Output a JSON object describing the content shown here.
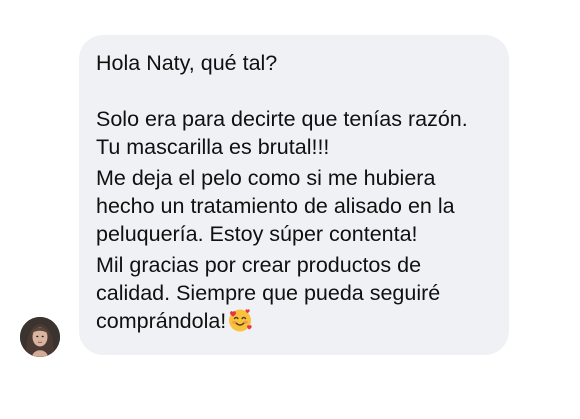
{
  "conversation": {
    "message": {
      "greeting": "Hola Naty, qué tal?",
      "paragraph_1": [
        "Solo era para decirte que tenías razón.",
        "Tu mascarilla es brutal!!!"
      ],
      "paragraph_2": [
        "Me deja el pelo como si me hubiera",
        "hecho un tratamiento de alisado en la",
        "peluquería. Estoy súper contenta!"
      ],
      "paragraph_3": [
        "Mil gracias por crear productos de",
        "calidad. Siempre que pueda seguiré",
        "comprándola!"
      ],
      "emoji_icon": "smiling-face-with-hearts-icon"
    },
    "sender": {
      "avatar_icon": "user-photo"
    }
  },
  "colors": {
    "bubble_background": "#f0f1f4",
    "text": "#101010",
    "emoji_face": "#f9c23c",
    "emoji_heart": "#e4334a"
  }
}
